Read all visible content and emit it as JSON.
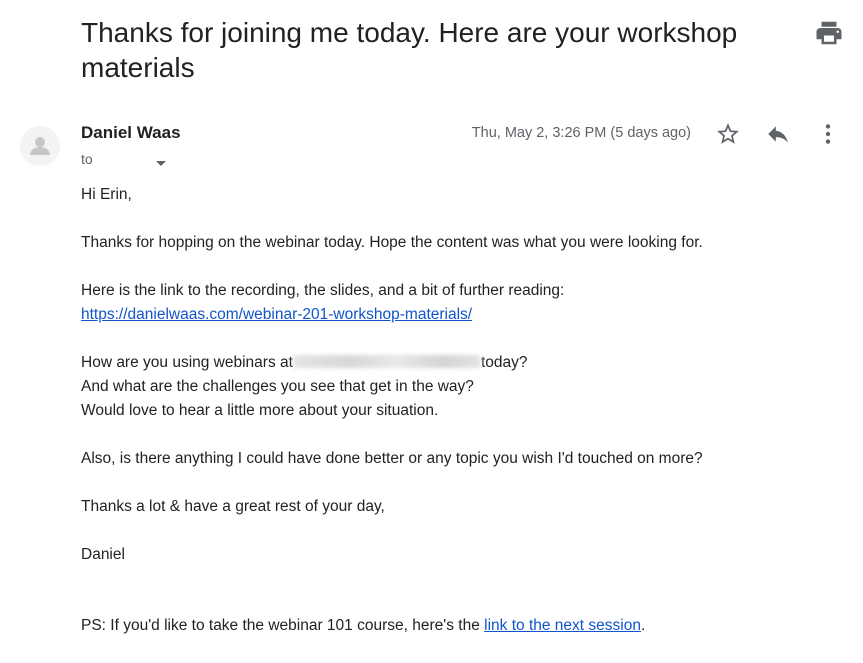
{
  "email": {
    "subject": "Thanks for joining me today. Here are your workshop materials",
    "sender_name": "Daniel Waas",
    "to_label": "to",
    "date": "Thu, May 2, 3:26 PM (5 days ago)",
    "body": {
      "greeting": "Hi Erin,",
      "para1": "Thanks for hopping on the webinar today. Hope the content was what you were looking for.",
      "para2_text": "Here is the link to the recording, the slides, and a bit of further reading:",
      "para2_link": "https://danielwaas.com/webinar-201-workshop-materials/",
      "para3_line1_before": "How are you using webinars at",
      "para3_line1_after": "today?",
      "para3_line2": "And what are the challenges you see that get in the way?",
      "para3_line3": "Would love to hear a little more about your situation.",
      "para4": "Also, is there anything I could have done better or any topic you wish I'd touched on more?",
      "para5": "Thanks a lot & have a great rest of your day,",
      "signature": "Daniel",
      "ps_text": "PS: If you'd like to take the webinar 101 course, here's the",
      "ps_link": "link to the next session",
      "ps_end": "."
    }
  },
  "icons": [
    "print-icon",
    "avatar-icon",
    "chevron-down-icon",
    "star-icon",
    "reply-icon",
    "more-vert-icon"
  ],
  "colors": {
    "link": "#1155cc",
    "secondary_text": "#5f6368",
    "icon": "#5f6368"
  }
}
